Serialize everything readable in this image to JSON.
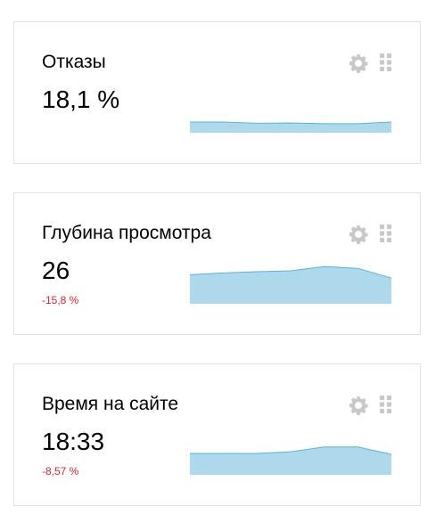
{
  "colors": {
    "sparkline_fill": "#aed8ec",
    "sparkline_stroke": "#5ab4d6",
    "negative_delta": "#d9262c",
    "icon": "#c8c8c8",
    "card_border": "#e2e2e2"
  },
  "icons": {
    "settings": "gear-icon",
    "drag": "drag-handle-icon"
  },
  "widgets": [
    {
      "title": "Отказы",
      "value": "18,1 %",
      "delta": "",
      "sparkline": [
        0.25,
        0.25,
        0.22,
        0.23,
        0.21,
        0.21,
        0.25
      ]
    },
    {
      "title": "Глубина просмотра",
      "value": "26",
      "delta": "-15,8 %",
      "sparkline": [
        0.68,
        0.72,
        0.75,
        0.77,
        0.87,
        0.83,
        0.6
      ]
    },
    {
      "title": "Время на сайте",
      "value": "18:33",
      "delta": "-8,57 %",
      "sparkline": [
        0.5,
        0.5,
        0.5,
        0.54,
        0.65,
        0.65,
        0.48
      ]
    }
  ]
}
